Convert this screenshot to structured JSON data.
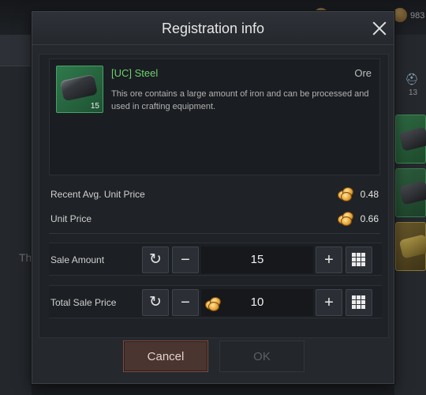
{
  "background": {
    "currency_partial": "983",
    "left_partial_text": "Th",
    "right_count": "13"
  },
  "dialog": {
    "title": "Registration info",
    "item": {
      "name": "[UC] Steel",
      "category": "Ore",
      "quantity": "15",
      "description": "This ore contains a large amount of iron and can be processed and used in crafting equipment.",
      "rarity_color": "#6ed06f"
    },
    "recent_avg_label": "Recent Avg. Unit Price",
    "recent_avg_value": "0.48",
    "unit_price_label": "Unit Price",
    "unit_price_value": "0.66",
    "sale_amount": {
      "label": "Sale Amount",
      "value": "15"
    },
    "total_sale_price": {
      "label": "Total Sale Price",
      "value": "10"
    },
    "buttons": {
      "cancel": "Cancel",
      "ok": "OK"
    },
    "icons": {
      "reset": "↻",
      "minus": "−",
      "plus": "+"
    },
    "colors": {
      "cancel_bg": "#4a3530",
      "ok_disabled_text": "#5c6066"
    }
  }
}
